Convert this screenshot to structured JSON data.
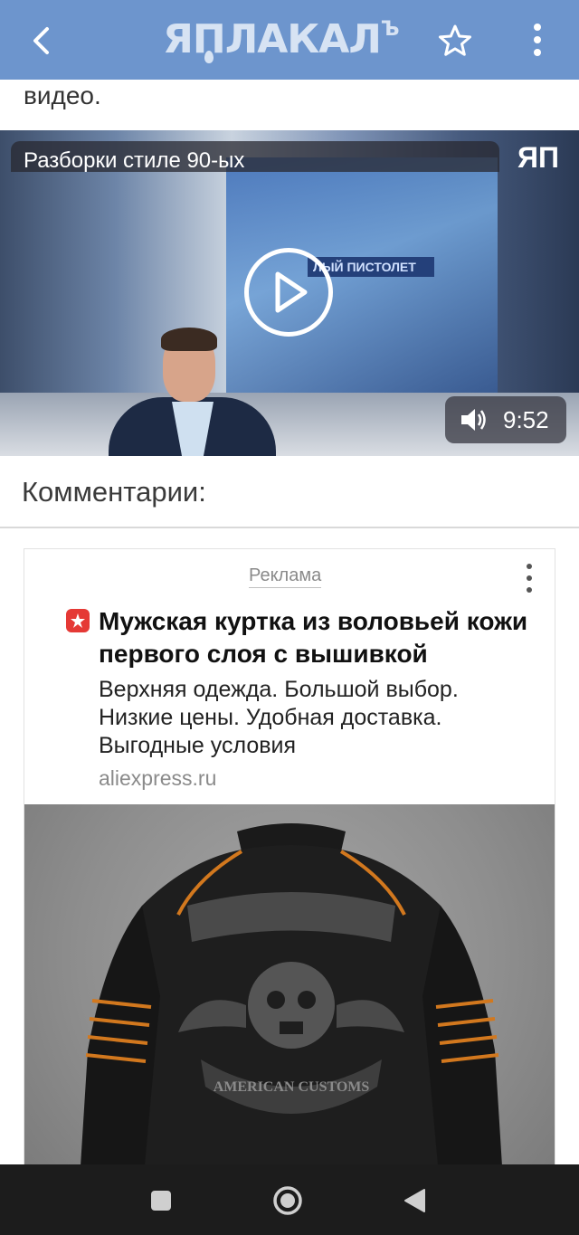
{
  "appbar": {
    "logo_text": "ЯПЛАКАЛ",
    "logo_sup": "Ъ",
    "back_icon": "chevron-left-icon",
    "favorite_icon": "star-outline-icon",
    "more_icon": "more-vertical-icon"
  },
  "post": {
    "top_text": "видео."
  },
  "video": {
    "title": "Разборки стиле 90-ых",
    "channel_logo": "ЯП",
    "screen_label": "ЛЫЙ ПИСТОЛЕТ",
    "duration": "9:52",
    "volume_icon": "volume-icon",
    "play_icon": "play-icon"
  },
  "comments": {
    "title": "Комментарии:"
  },
  "ad": {
    "label": "Реклама",
    "title": "Мужская куртка из воловьей кожи первого слоя с вышивкой",
    "description": "Верхняя одежда. Большой выбор. Низкие цены. Удобная доставка. Выгодные условия",
    "domain": "aliexpress.ru",
    "brand_color": "#e53935",
    "image_caption": "AMERICAN CUSTOMS"
  },
  "navbar": {
    "recents_icon": "square-icon",
    "home_icon": "circle-icon",
    "back_icon": "triangle-back-icon"
  },
  "colors": {
    "appbar": "#6d95cd",
    "navbar": "#1c1c1c"
  }
}
